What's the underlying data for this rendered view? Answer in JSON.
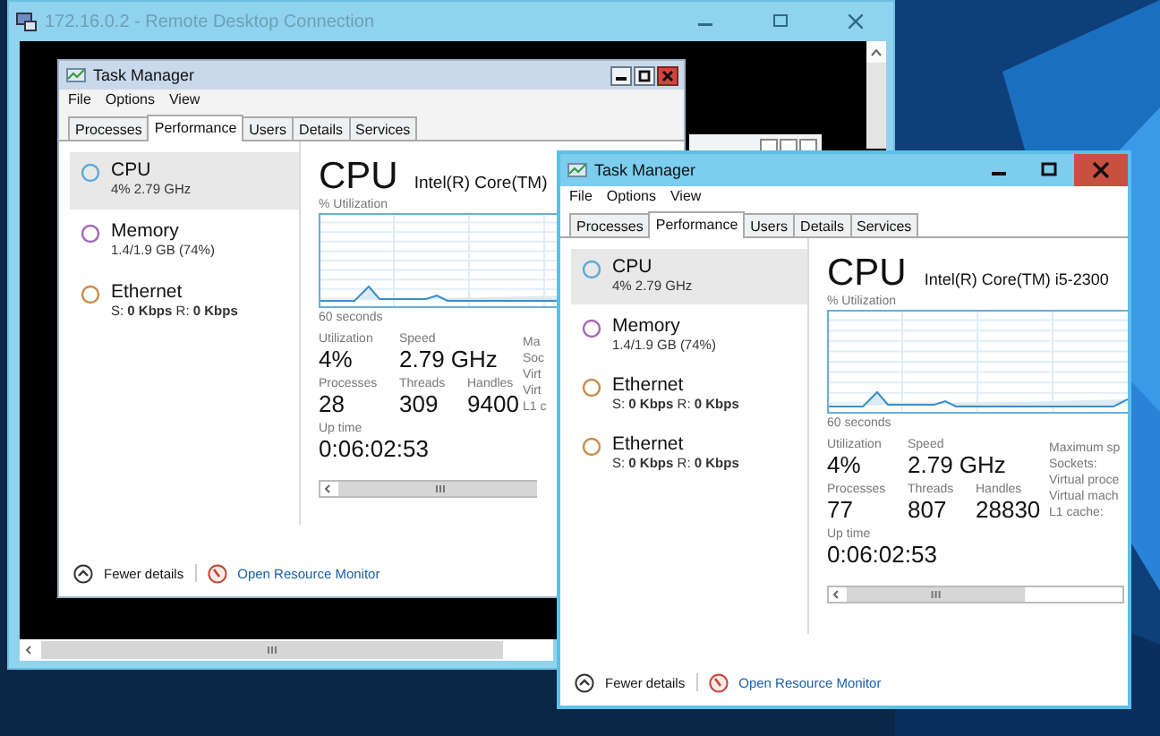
{
  "remote_window": {
    "title": "172.16.0.2 - Remote Desktop Connection",
    "task_manager": {
      "title": "Task Manager",
      "menu": [
        "File",
        "Options",
        "View"
      ],
      "tabs": [
        {
          "label": "Processes",
          "selected": false
        },
        {
          "label": "Performance",
          "selected": true
        },
        {
          "label": "Users",
          "selected": false
        },
        {
          "label": "Details",
          "selected": false
        },
        {
          "label": "Services",
          "selected": false
        }
      ],
      "resources": [
        {
          "name": "CPU",
          "detail": "4% 2.79 GHz",
          "color": "#5fa8d8",
          "selected": true
        },
        {
          "name": "Memory",
          "detail": "1.4/1.9 GB (74%)",
          "color": "#a366b5",
          "selected": false
        },
        {
          "name": "Ethernet",
          "detail": "S: **0 Kbps** R: **0 Kbps**",
          "color": "#c88c4a",
          "selected": false
        }
      ],
      "detail": {
        "heading": "CPU",
        "model": "Intel(R) Core(TM)",
        "graph_label": "% Utilization",
        "graph_footer": "60 seconds",
        "stats": [
          [
            {
              "label": "Utilization",
              "value": "4%"
            },
            {
              "label": "Speed",
              "value": "2.79 GHz"
            }
          ],
          [
            {
              "label": "Processes",
              "value": "28"
            },
            {
              "label": "Threads",
              "value": "309"
            },
            {
              "label": "Handles",
              "value": "9400"
            }
          ],
          [
            {
              "label": "Up time",
              "value": "0:06:02:53"
            }
          ]
        ],
        "side_labels": [
          "Ma",
          "Soc",
          "Virt",
          "Virt",
          "L1 c"
        ]
      },
      "footer": {
        "toggle": "Fewer details",
        "link": "Open Resource Monitor"
      }
    }
  },
  "task_manager": {
    "title": "Task Manager",
    "menu": [
      "File",
      "Options",
      "View"
    ],
    "tabs": [
      {
        "label": "Processes",
        "selected": false
      },
      {
        "label": "Performance",
        "selected": true
      },
      {
        "label": "Users",
        "selected": false
      },
      {
        "label": "Details",
        "selected": false
      },
      {
        "label": "Services",
        "selected": false
      }
    ],
    "resources": [
      {
        "name": "CPU",
        "detail": "4% 2.79 GHz",
        "color": "#5fa8d8",
        "selected": true
      },
      {
        "name": "Memory",
        "detail": "1.4/1.9 GB (74%)",
        "color": "#a366b5",
        "selected": false
      },
      {
        "name": "Ethernet",
        "detail": "S: **0 Kbps** R: **0 Kbps**",
        "color": "#c88c4a",
        "selected": false
      },
      {
        "name": "Ethernet",
        "detail": "S: **0 Kbps** R: **0 Kbps**",
        "color": "#c88c4a",
        "selected": false
      }
    ],
    "detail": {
      "heading": "CPU",
      "model": "Intel(R) Core(TM) i5-2300",
      "graph_label": "% Utilization",
      "graph_footer": "60 seconds",
      "stats": [
        [
          {
            "label": "Utilization",
            "value": "4%"
          },
          {
            "label": "Speed",
            "value": "2.79 GHz"
          }
        ],
        [
          {
            "label": "Processes",
            "value": "77"
          },
          {
            "label": "Threads",
            "value": "807"
          },
          {
            "label": "Handles",
            "value": "28830"
          }
        ],
        [
          {
            "label": "Up time",
            "value": "0:06:02:53"
          }
        ]
      ],
      "side_labels": [
        "Maximum sp",
        "Sockets:",
        "Virtual proce",
        "Virtual mach",
        "L1 cache:"
      ]
    },
    "footer": {
      "toggle": "Fewer details",
      "link": "Open Resource Monitor"
    }
  }
}
